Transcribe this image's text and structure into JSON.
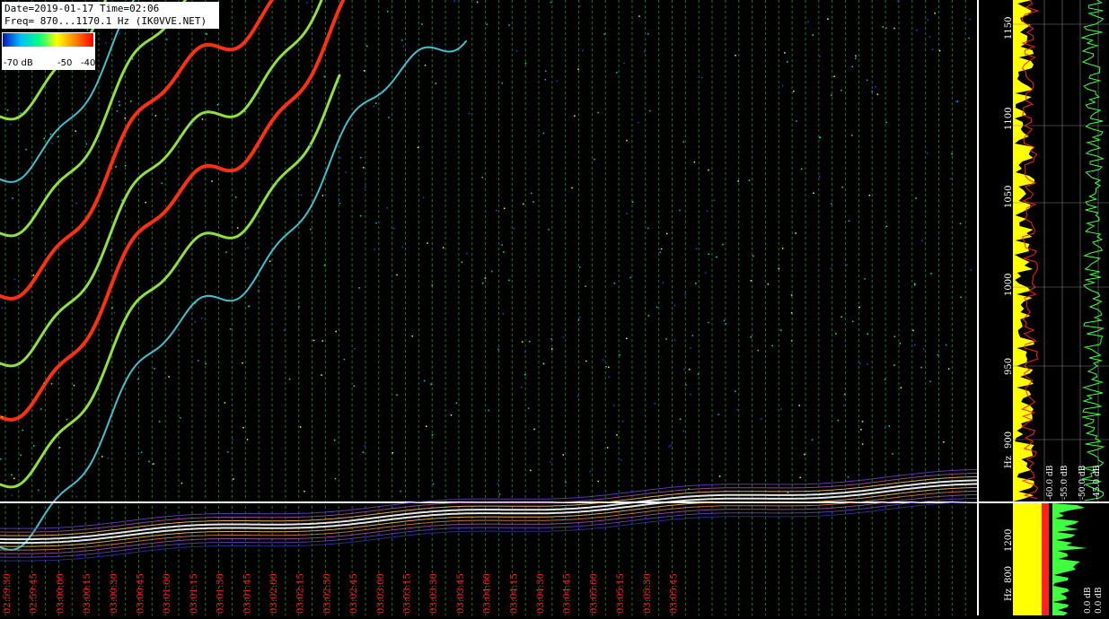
{
  "info": {
    "line1": "Date=2019-01-17 Time=02:06",
    "line2": "Freq= 870...1170.1 Hz (IK0VVE.NET)"
  },
  "scale": {
    "min_label": "-70 dB",
    "mid_label": "-50",
    "max_label": "-40",
    "colors": [
      "#1010c0",
      "#00c0ff",
      "#00ff80",
      "#ffff00",
      "#ff8000",
      "#ff0000"
    ]
  },
  "freq_axis": {
    "labels": [
      "1150",
      "1100",
      "1050",
      "1000",
      "950",
      "900",
      "Hz"
    ]
  },
  "lower_freq_axis": {
    "labels": [
      "1200",
      "800",
      "Hz"
    ]
  },
  "db_axis": {
    "labels": [
      "-60.0 dB",
      "-55.0 dB",
      "-50.0 dB",
      "-45.0 dB"
    ],
    "lower_labels": [
      "0.0 dB",
      "0.0 dB"
    ]
  },
  "time_axis": {
    "labels": [
      "02:59:30",
      "02:59:45",
      "03:00:00",
      "03:00:15",
      "03:00:30",
      "03:00:45",
      "03:01:00",
      "03:01:15",
      "03:01:30",
      "03:01:45",
      "03:02:00",
      "03:02:15",
      "03:02:30",
      "03:02:45",
      "03:03:00",
      "03:03:15",
      "03:03:30",
      "03:03:45",
      "03:04:00",
      "03:04:15",
      "03:04:30",
      "03:04:45",
      "03:05:00",
      "03:05:15",
      "03:05:30",
      "03:05:45"
    ]
  },
  "colors": {
    "time_label": "#ff2020",
    "grid": "#1e7a1e",
    "panel_yellow": "#ffff00",
    "spectrum_green": "#40ff40",
    "peak_red": "#ff2020"
  }
}
